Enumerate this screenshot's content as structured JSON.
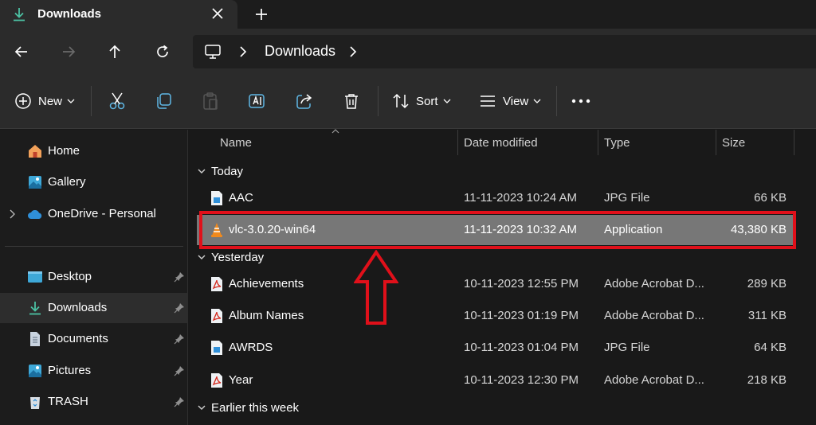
{
  "colors": {
    "highlight": "#e0101a",
    "accent": "#3ea8d8",
    "selected_row": "#777777"
  },
  "tab": {
    "title": "Downloads",
    "icon": "download-icon",
    "close_icon": "close-icon",
    "new_tab_icon": "plus-icon"
  },
  "nav": {
    "back_icon": "arrow-left-icon",
    "forward_icon": "arrow-right-icon",
    "up_icon": "arrow-up-icon",
    "refresh_icon": "refresh-icon",
    "breadcrumb": [
      "Downloads"
    ]
  },
  "toolbar": {
    "new_label": "New",
    "sort_label": "Sort",
    "view_label": "View",
    "icons": [
      "cut-icon",
      "copy-icon",
      "paste-icon",
      "rename-icon",
      "share-icon",
      "delete-icon",
      "more-icon"
    ]
  },
  "sidebar": {
    "items": [
      {
        "label": "Home",
        "icon": "home-icon"
      },
      {
        "label": "Gallery",
        "icon": "gallery-icon"
      },
      {
        "label": "OneDrive - Personal",
        "icon": "cloud-icon"
      },
      {
        "label": "Desktop",
        "icon": "desktop-icon",
        "pinned": true
      },
      {
        "label": "Downloads",
        "icon": "download-icon",
        "pinned": true,
        "active": true
      },
      {
        "label": "Documents",
        "icon": "document-icon",
        "pinned": true
      },
      {
        "label": "Pictures",
        "icon": "pictures-icon",
        "pinned": true
      },
      {
        "label": "TRASH",
        "icon": "recycle-icon",
        "pinned": true
      }
    ]
  },
  "files": {
    "columns": [
      "Name",
      "Date modified",
      "Type",
      "Size"
    ],
    "groups": [
      {
        "label": "Today",
        "rows": [
          {
            "name": "AAC",
            "date": "11-11-2023 10:24 AM",
            "type": "JPG File",
            "size": "66 KB",
            "icon": "image-file-icon"
          },
          {
            "name": "vlc-3.0.20-win64",
            "date": "11-11-2023 10:32 AM",
            "type": "Application",
            "size": "43,380 KB",
            "icon": "vlc-icon",
            "selected": true
          }
        ]
      },
      {
        "label": "Yesterday",
        "rows": [
          {
            "name": "Achievements",
            "date": "10-11-2023 12:55 PM",
            "type": "Adobe Acrobat D...",
            "size": "289 KB",
            "icon": "pdf-icon"
          },
          {
            "name": "Album Names",
            "date": "10-11-2023 01:19 PM",
            "type": "Adobe Acrobat D...",
            "size": "311 KB",
            "icon": "pdf-icon"
          },
          {
            "name": "AWRDS",
            "date": "10-11-2023 01:04 PM",
            "type": "JPG File",
            "size": "64 KB",
            "icon": "image-file-icon"
          },
          {
            "name": "Year",
            "date": "10-11-2023 12:30 PM",
            "type": "Adobe Acrobat D...",
            "size": "218 KB",
            "icon": "pdf-icon"
          }
        ]
      },
      {
        "label": "Earlier this week",
        "rows": []
      }
    ]
  }
}
